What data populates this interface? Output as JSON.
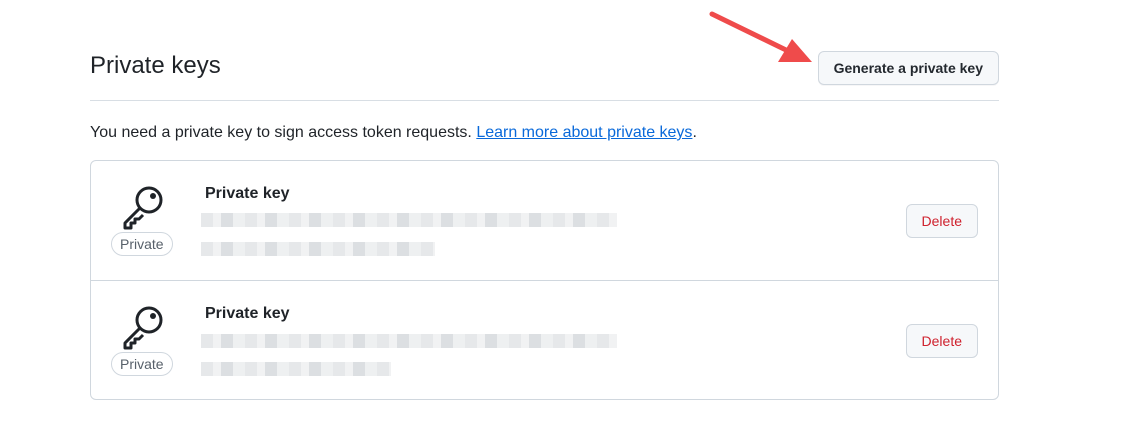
{
  "header": {
    "title": "Private keys",
    "generate_button": "Generate a private key"
  },
  "description": {
    "text": "You need a private key to sign access token requests. ",
    "link": "Learn more about private keys",
    "suffix": "."
  },
  "keys": [
    {
      "title": "Private key",
      "badge": "Private",
      "delete_label": "Delete"
    },
    {
      "title": "Private key",
      "badge": "Private",
      "delete_label": "Delete"
    }
  ],
  "colors": {
    "annotation_arrow": "#ef4b4b",
    "link": "#0969da",
    "danger": "#cf222e"
  },
  "icons": {
    "key": "key-icon",
    "annotation": "arrow-annotation"
  }
}
